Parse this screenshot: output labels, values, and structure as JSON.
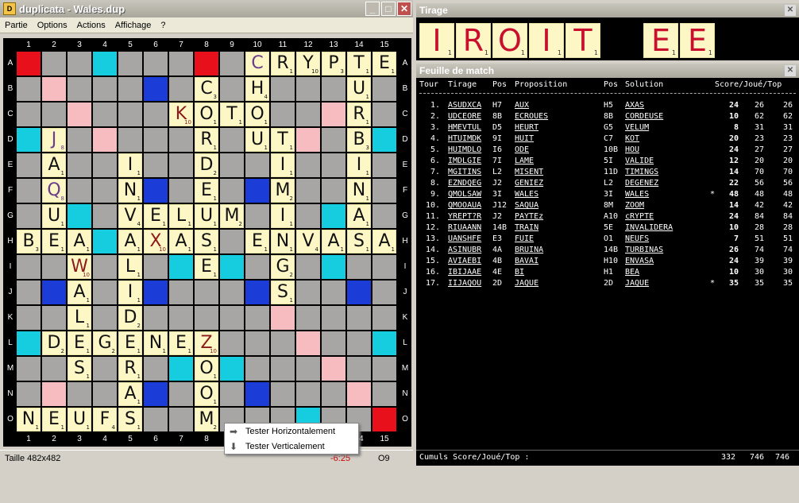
{
  "main_window": {
    "title": "duplicata - Wales.dup",
    "menu": [
      "Partie",
      "Options",
      "Actions",
      "Affichage",
      "?"
    ],
    "status_size": "Taille 482x482",
    "status_score": "-6:25",
    "status_pos": "O9"
  },
  "board": {
    "col_labels": [
      "1",
      "2",
      "3",
      "4",
      "5",
      "6",
      "7",
      "8",
      "9",
      "10",
      "11",
      "12",
      "13",
      "14",
      "15"
    ],
    "row_labels": [
      "A",
      "B",
      "C",
      "D",
      "E",
      "F",
      "G",
      "H",
      "I",
      "J",
      "K",
      "L",
      "M",
      "N",
      "O"
    ]
  },
  "context_menu": {
    "items": [
      {
        "label": "Tester Horizontalement",
        "icon": "arrow-right-icon"
      },
      {
        "label": "Tester Verticalement",
        "icon": "arrow-down-icon"
      }
    ]
  },
  "tirage_window": {
    "title": "Tirage",
    "tiles": [
      {
        "letter": "I",
        "value": "1"
      },
      {
        "letter": "R",
        "value": "1"
      },
      {
        "letter": "O",
        "value": "1"
      },
      {
        "letter": "I",
        "value": "1"
      },
      {
        "letter": "T",
        "value": "1"
      },
      {
        "letter": "E",
        "value": "1"
      },
      {
        "letter": "E",
        "value": "1"
      }
    ]
  },
  "feuille_window": {
    "title": "Feuille de match",
    "headers": {
      "tour": "Tour",
      "tirage": "Tirage",
      "pos": "Pos",
      "proposition": "Proposition",
      "pos2": "Pos",
      "solution": "Solution",
      "scores": "Score/Joué/Top"
    },
    "rows": [
      {
        "n": "1.",
        "tirage": "ASUDXCA",
        "pos": "H7",
        "prop": "AUX",
        "pos2": "H5",
        "sol": "AXAS",
        "star": "",
        "score": "24",
        "joue": "26",
        "top": "26"
      },
      {
        "n": "2.",
        "tirage": "UDCEORE",
        "pos": "8B",
        "prop": "ECROUES",
        "pos2": "8B",
        "sol": "CORDEUSE",
        "star": "",
        "score": "10",
        "joue": "62",
        "top": "62"
      },
      {
        "n": "3.",
        "tirage": "HMEVTUL",
        "pos": "D5",
        "prop": "HEURT",
        "pos2": "G5",
        "sol": "VELUM",
        "star": "",
        "score": "8",
        "joue": "31",
        "top": "31"
      },
      {
        "n": "4.",
        "tirage": "HTUIMDK",
        "pos": "9I",
        "prop": "HUIT",
        "pos2": "C7",
        "sol": "KOT",
        "star": "",
        "score": "20",
        "joue": "23",
        "top": "23"
      },
      {
        "n": "5.",
        "tirage": "HUIMDLO",
        "pos": "I6",
        "prop": "ODE",
        "pos2": "10B",
        "sol": "HOU",
        "star": "",
        "score": "24",
        "joue": "27",
        "top": "27"
      },
      {
        "n": "6.",
        "tirage": "IMDLGIE",
        "pos": "7I",
        "prop": "LAME",
        "pos2": "5I",
        "sol": "VALIDE",
        "star": "",
        "score": "12",
        "joue": "20",
        "top": "20"
      },
      {
        "n": "7.",
        "tirage": "MGITINS",
        "pos": "L2",
        "prop": "MISENT",
        "pos2": "11D",
        "sol": "TIMINGS",
        "star": "",
        "score": "14",
        "joue": "70",
        "top": "70"
      },
      {
        "n": "8.",
        "tirage": "EZNDQEG",
        "pos": "J2",
        "prop": "GENIEZ",
        "pos2": "L2",
        "sol": "DEGENEZ",
        "star": "",
        "score": "22",
        "joue": "56",
        "top": "56"
      },
      {
        "n": "9.",
        "tirage": "QMOLSAW",
        "pos": "3I",
        "prop": "WALES",
        "pos2": "3I",
        "sol": "WALES",
        "star": "*",
        "score": "48",
        "joue": "48",
        "top": "48"
      },
      {
        "n": "10.",
        "tirage": "QMOOAUA",
        "pos": "J12",
        "prop": "SAQUA",
        "pos2": "8M",
        "sol": "ZOOM",
        "star": "",
        "score": "14",
        "joue": "42",
        "top": "42"
      },
      {
        "n": "11.",
        "tirage": "YREPT?R",
        "pos": "J2",
        "prop": "PAYTEz",
        "pos2": "A10",
        "sol": "cRYPTE",
        "star": "",
        "score": "24",
        "joue": "84",
        "top": "84"
      },
      {
        "n": "12.",
        "tirage": "RIUAANN",
        "pos": "14B",
        "prop": "TRAIN",
        "pos2": "5E",
        "sol": "INVALIDERA",
        "star": "",
        "score": "10",
        "joue": "28",
        "top": "28"
      },
      {
        "n": "13.",
        "tirage": "UANSHFE",
        "pos": "E3",
        "prop": "FUIE",
        "pos2": "O1",
        "sol": "NEUFS",
        "star": "",
        "score": "7",
        "joue": "51",
        "top": "51"
      },
      {
        "n": "14.",
        "tirage": "ASINUBR",
        "pos": "4A",
        "prop": "BRUINA",
        "pos2": "14B",
        "sol": "TURBINAS",
        "star": "",
        "score": "26",
        "joue": "74",
        "top": "74"
      },
      {
        "n": "15.",
        "tirage": "AVIAEBI",
        "pos": "4B",
        "prop": "BAVAI",
        "pos2": "H10",
        "sol": "ENVASA",
        "star": "",
        "score": "24",
        "joue": "39",
        "top": "39"
      },
      {
        "n": "16.",
        "tirage": "IBIJAAE",
        "pos": "4E",
        "prop": "BI",
        "pos2": "H1",
        "sol": "BEA",
        "star": "",
        "score": "10",
        "joue": "30",
        "top": "30"
      },
      {
        "n": "17.",
        "tirage": "IIJAQOU",
        "pos": "2D",
        "prop": "JAQUE",
        "pos2": "2D",
        "sol": "JAQUE",
        "star": "*",
        "score": "35",
        "joue": "35",
        "top": "35"
      }
    ],
    "footer": {
      "label": "Cumuls Score/Joué/Top :",
      "score": "332",
      "joue": "746",
      "top": "746"
    }
  },
  "colors": {
    "triple_word": "#e8101a",
    "double_word": "#f6bcc0",
    "triple_letter": "#1b3cd6",
    "double_letter": "#16cde0",
    "tile": "#fdf7c6",
    "tirage_letter": "#c8102e"
  }
}
